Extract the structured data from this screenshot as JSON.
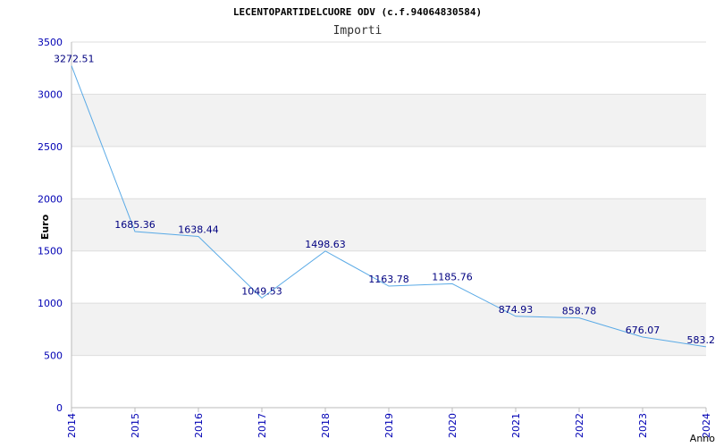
{
  "chart_data": {
    "type": "line",
    "title": "LECENTOPARTIDELCUORE ODV (c.f.94064830584)",
    "subtitle": "Importi",
    "xlabel": "Anno",
    "ylabel": "Euro",
    "categories": [
      "2014",
      "2015",
      "2016",
      "2017",
      "2018",
      "2019",
      "2020",
      "2021",
      "2022",
      "2023",
      "2024"
    ],
    "series": [
      {
        "values": [
          3272.51,
          1685.36,
          1638.44,
          1049.53,
          1498.63,
          1163.78,
          1185.76,
          874.93,
          858.78,
          676.07,
          583.2
        ],
        "labels": [
          "3272.51",
          "1685.36",
          "1638.44",
          "1049.53",
          "1498.63",
          "1163.78",
          "1185.76",
          "874.93",
          "858.78",
          "676.07",
          "583.2"
        ]
      }
    ],
    "ylim": [
      0,
      3500
    ],
    "yticks": [
      0,
      500,
      1000,
      1500,
      2000,
      2500,
      3000,
      3500
    ],
    "grid": true,
    "colors": {
      "line": "#5aaae6",
      "labels": "#000080",
      "ticks": "#0000b4",
      "band": "#f2f2f2",
      "gridline": "#dddddd",
      "axis": "#bbbbbb"
    }
  }
}
